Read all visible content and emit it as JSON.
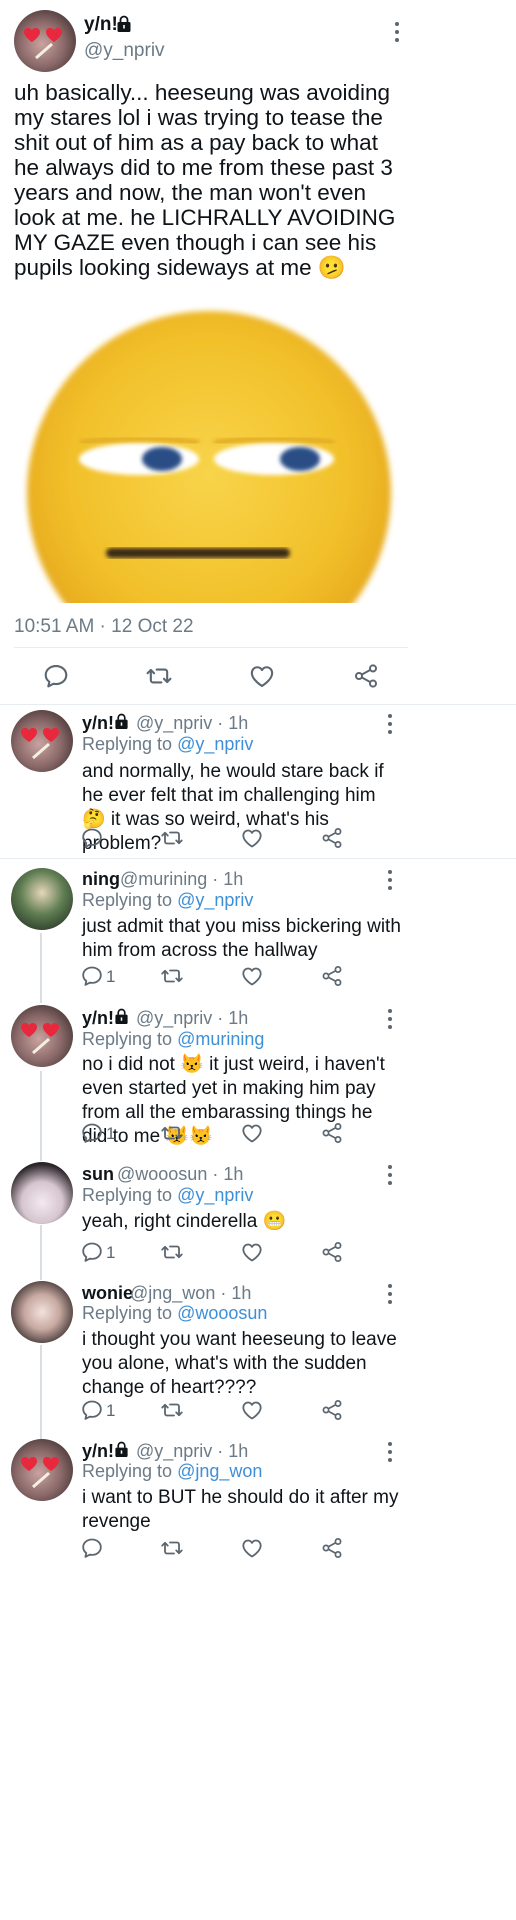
{
  "main_tweet": {
    "display_name": "y/n!",
    "handle": "@y_npriv",
    "text": "uh basically... heeseung was avoiding my stares lol i was trying to tease the shit out of him as a pay back to what he always did to me from these past 3 years and now, the man won't even look at me. he LICHRALLY AVOIDING MY GAZE even though i can see his pupils looking sideways at me 🫤",
    "timestamp": "10:51 AM · 12 Oct 22",
    "image_icon": "side-eye-emoji"
  },
  "replies": [
    {
      "display_name": "y/n!",
      "handle_time": "@y_npriv · 1h",
      "replying_prefix": "Replying to ",
      "replying_to": "@y_npriv",
      "text": "and normally, he would stare back if he ever felt that im challenging him 🤔 it was so weird, what's his problem?",
      "reply_count": ""
    },
    {
      "display_name": "ning",
      "handle_time": "@murining · 1h",
      "replying_prefix": "Replying to ",
      "replying_to": "@y_npriv",
      "text": "just admit that you miss bickering with him from across the hallway",
      "reply_count": "1"
    },
    {
      "display_name": "y/n!",
      "handle_time": "@y_npriv · 1h",
      "replying_prefix": "Replying to ",
      "replying_to": "@murining",
      "text": "no i did not 😾 it just weird, i haven't even started yet in making him pay from all the embarassing things he did to me 😾😾",
      "reply_count": "1"
    },
    {
      "display_name": "sun",
      "handle_time": "@wooosun · 1h",
      "replying_prefix": "Replying to ",
      "replying_to": "@y_npriv",
      "text": "yeah, right cinderella 😬",
      "reply_count": "1"
    },
    {
      "display_name": "wonie",
      "handle_time": "@jng_won · 1h",
      "replying_prefix": "Replying to ",
      "replying_to": "@wooosun",
      "text": "i thought you want heeseung to leave you alone, what's with the sudden change of heart????",
      "reply_count": "1"
    },
    {
      "display_name": "y/n!",
      "handle_time": "@y_npriv · 1h",
      "replying_prefix": "Replying to ",
      "replying_to": "@jng_won",
      "text": "i want to BUT he should do it after my revenge",
      "reply_count": ""
    }
  ],
  "colors": {
    "link": "#3f8fd6",
    "muted": "#6b7a86",
    "divider": "#e6ecf0",
    "emoji_yellow": "#f6c531"
  },
  "icons": [
    "lock-icon",
    "more-icon",
    "reply-icon",
    "retweet-icon",
    "like-icon",
    "share-icon"
  ]
}
